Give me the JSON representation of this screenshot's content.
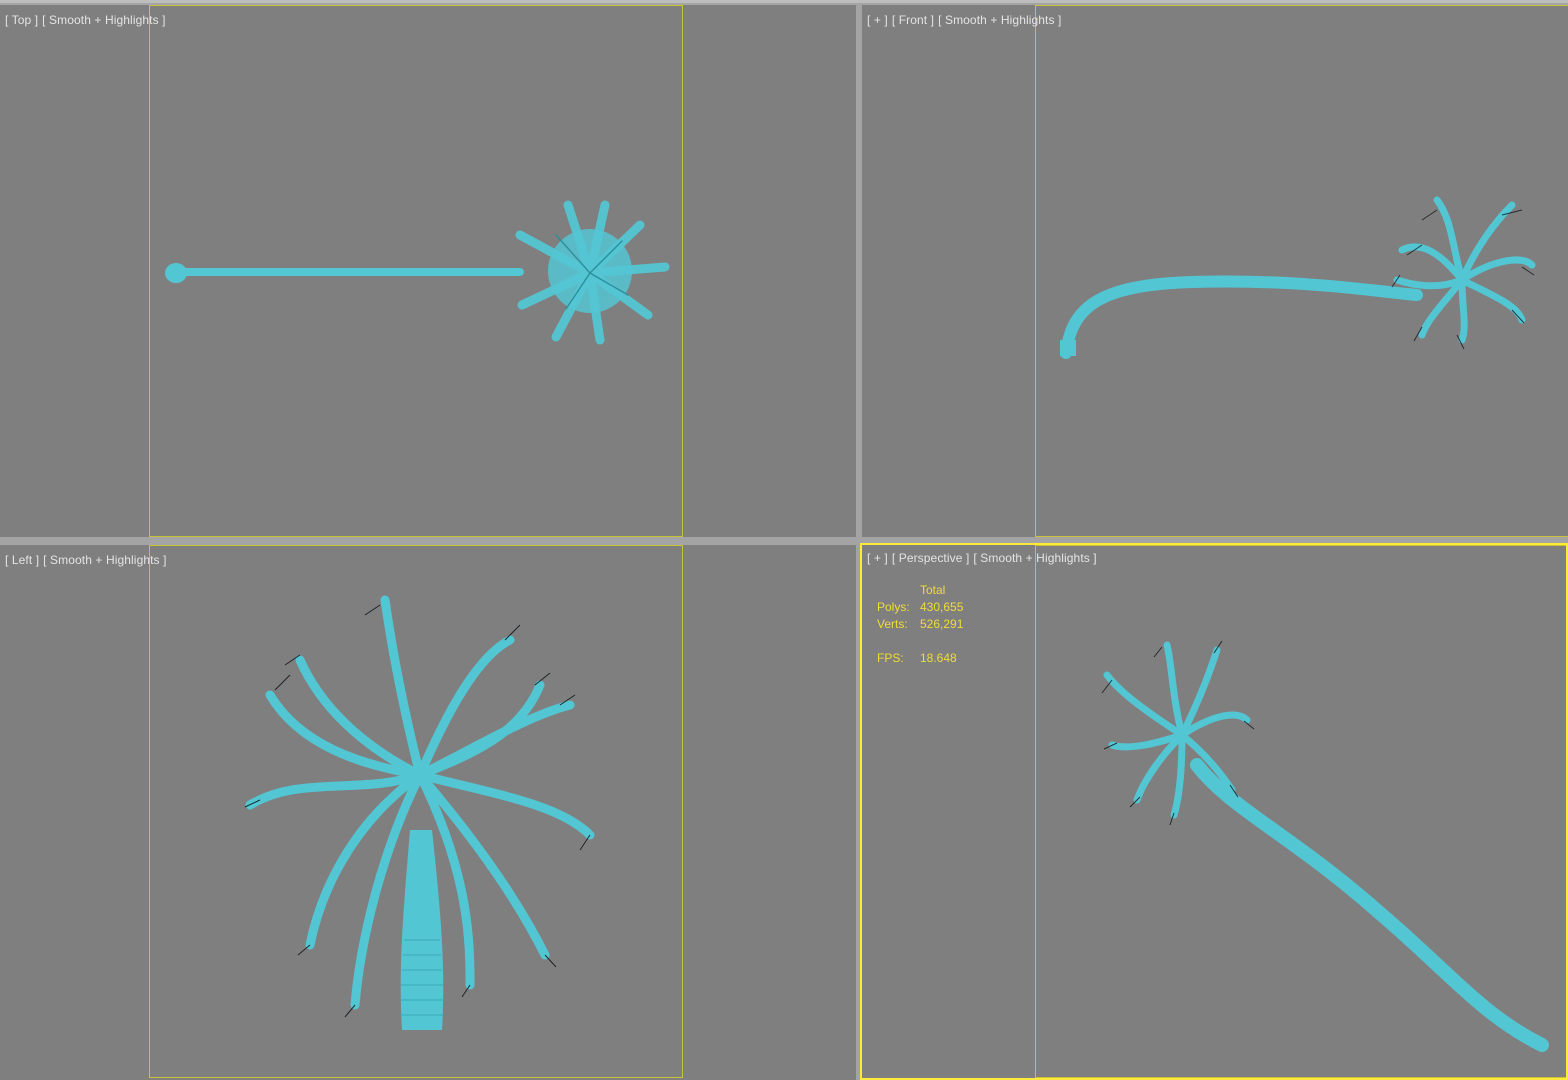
{
  "viewports": {
    "top": {
      "labels": [
        "[ Top ]",
        "[ Smooth + Highlights ]"
      ]
    },
    "front": {
      "labels": [
        "[ + ]",
        "[ Front ]",
        "[ Smooth + Highlights ]"
      ]
    },
    "left": {
      "labels": [
        "[ Left ]",
        "[ Smooth + Highlights ]"
      ]
    },
    "perspective": {
      "labels": [
        "[ + ]",
        "[ Perspective ]",
        "[ Smooth + Highlights ]"
      ],
      "active": true,
      "stats": {
        "header": "Total",
        "polys_label": "Polys:",
        "polys_value": "430,655",
        "verts_label": "Verts:",
        "verts_value": "526,291",
        "fps_label": "FPS:",
        "fps_value": "18.648"
      }
    }
  },
  "colors": {
    "viewport_bg": "#7f7f7f",
    "frame_border": "#a4a4a4",
    "safe_frame": "#c7c23a",
    "active_border": "#ffea3a",
    "model": "#53c6d3",
    "stats_text": "#f0dc37"
  }
}
